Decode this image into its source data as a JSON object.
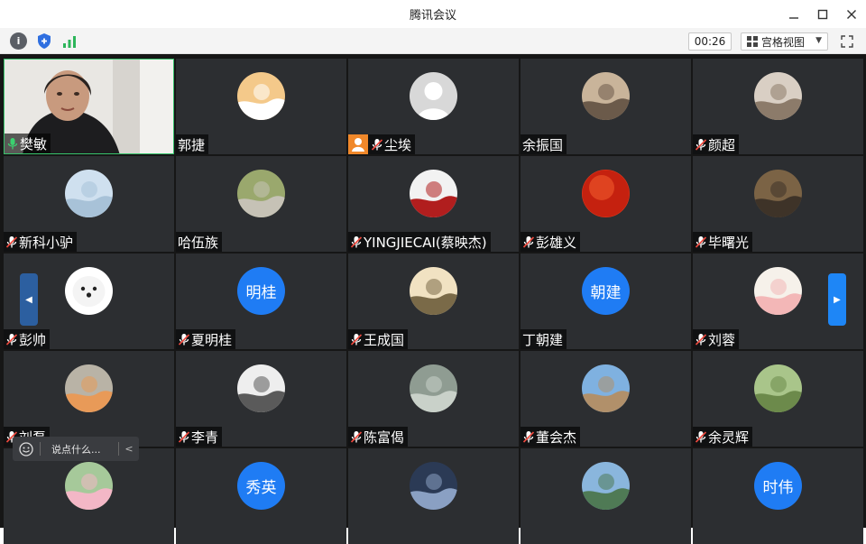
{
  "window": {
    "title": "腾讯会议"
  },
  "toolbar": {
    "timer": "00:26",
    "view_mode": "宫格视图",
    "accent": "#1e86f6"
  },
  "chat": {
    "placeholder": "说点什么..."
  },
  "participants": [
    {
      "name": "樊敏",
      "mic": "on",
      "avatar": "camera-video",
      "active": true
    },
    {
      "name": "郭捷",
      "mic": "none",
      "avatar": "cartoon-avatar"
    },
    {
      "name": "尘埃",
      "mic": "muted",
      "avatar": "default-avatar",
      "host": true
    },
    {
      "name": "余振国",
      "mic": "none",
      "avatar": "photo-wall-avatar"
    },
    {
      "name": "颜超",
      "mic": "muted",
      "avatar": "baby-photo-avatar"
    },
    {
      "name": "新科小驴",
      "mic": "muted",
      "avatar": "anime-avatar"
    },
    {
      "name": "哈伍族",
      "mic": "none",
      "avatar": "bike-photo-avatar"
    },
    {
      "name": "YINGJIECAI(蔡映杰)",
      "mic": "muted",
      "avatar": "old-man-cartoon-avatar"
    },
    {
      "name": "彭雄义",
      "mic": "muted",
      "avatar": "red-circle-avatar"
    },
    {
      "name": "毕曙光",
      "mic": "muted",
      "avatar": "woman-photo-avatar"
    },
    {
      "name": "彭帅",
      "mic": "muted",
      "avatar": "white-dog-avatar"
    },
    {
      "name": "夏明桂",
      "mic": "muted",
      "avatar": "text",
      "initials": "明桂"
    },
    {
      "name": "王成国",
      "mic": "muted",
      "avatar": "calligraphy-avatar"
    },
    {
      "name": "丁朝建",
      "mic": "none",
      "avatar": "text",
      "initials": "朝建"
    },
    {
      "name": "刘蓉",
      "mic": "muted",
      "avatar": "kids-cartoon-avatar"
    },
    {
      "name": "刘磊",
      "mic": "muted",
      "avatar": "sunset-avatar"
    },
    {
      "name": "李青",
      "mic": "muted",
      "avatar": "business-woman-avatar"
    },
    {
      "name": "陈富偈",
      "mic": "muted",
      "avatar": "river-rocks-avatar"
    },
    {
      "name": "董会杰",
      "mic": "muted",
      "avatar": "beach-avatar"
    },
    {
      "name": "余灵辉",
      "mic": "muted",
      "avatar": "trees-avatar"
    },
    {
      "name": "",
      "mic": "none",
      "avatar": "heart-flowers-avatar"
    },
    {
      "name": "",
      "mic": "none",
      "avatar": "text",
      "initials": "秀英"
    },
    {
      "name": "",
      "mic": "none",
      "avatar": "baby-car-avatar"
    },
    {
      "name": "",
      "mic": "none",
      "avatar": "mountain-lake-avatar"
    },
    {
      "name": "",
      "mic": "none",
      "avatar": "text",
      "initials": "时伟"
    }
  ]
}
